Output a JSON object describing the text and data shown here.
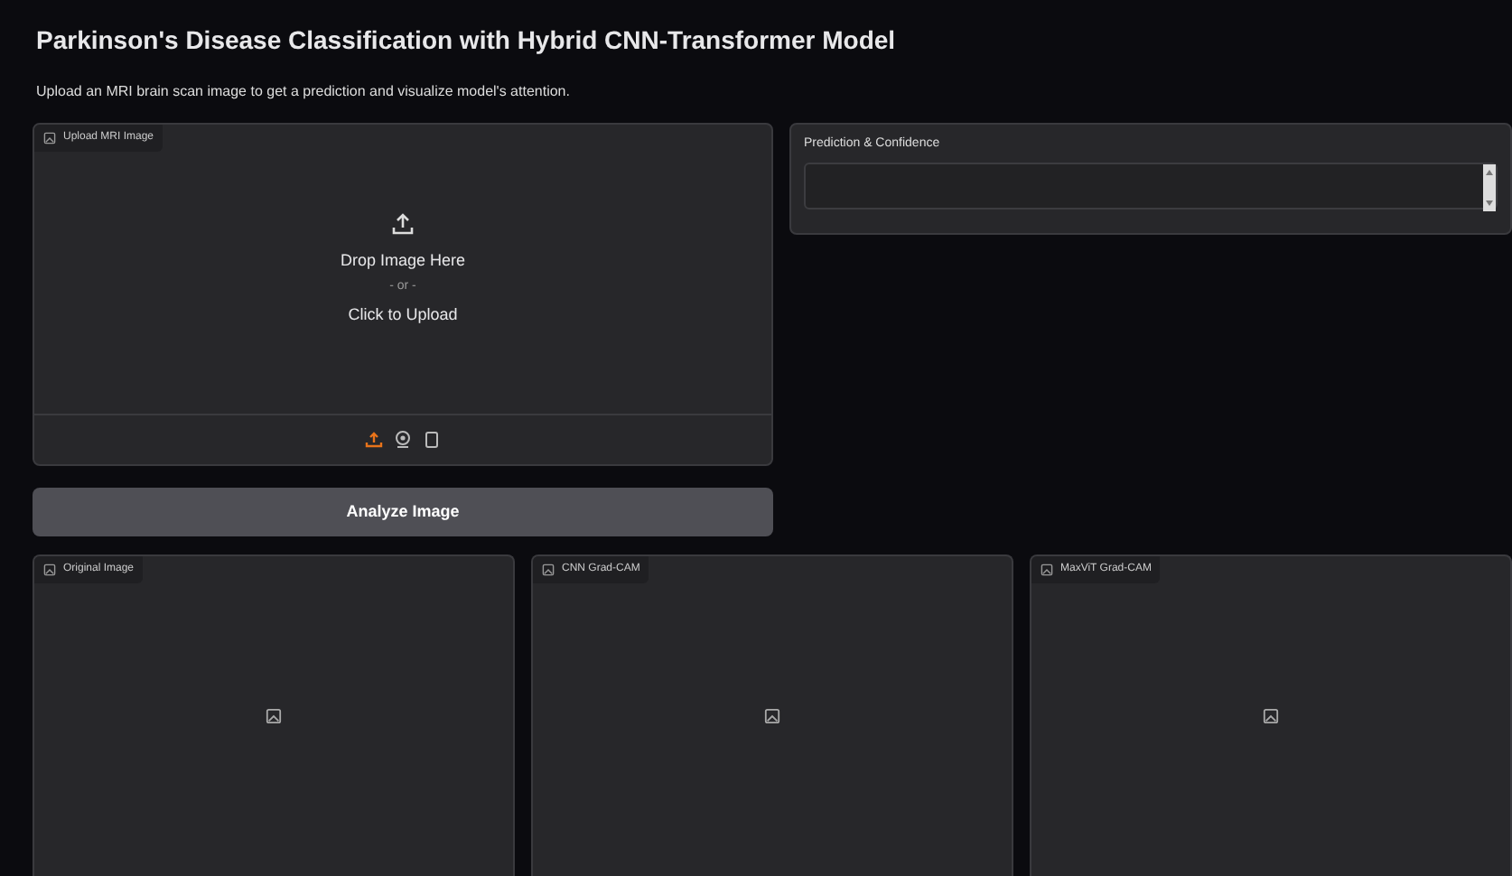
{
  "title": "Parkinson's Disease Classification with Hybrid CNN-Transformer Model",
  "subtitle": "Upload an MRI brain scan image to get a prediction and visualize model's attention.",
  "upload": {
    "label": "Upload MRI Image",
    "drop_text": "Drop Image Here",
    "or_text": "- or -",
    "click_text": "Click to Upload",
    "sources": [
      {
        "kind": "upload",
        "selected": true
      },
      {
        "kind": "webcam",
        "selected": false
      },
      {
        "kind": "clipboard",
        "selected": false
      }
    ]
  },
  "prediction": {
    "label": "Prediction & Confidence"
  },
  "analyze_button": "Analyze Image",
  "outputs": [
    {
      "label": "Original Image"
    },
    {
      "label": "CNN Grad-CAM"
    },
    {
      "label": "MaxViT Grad-CAM"
    }
  ]
}
